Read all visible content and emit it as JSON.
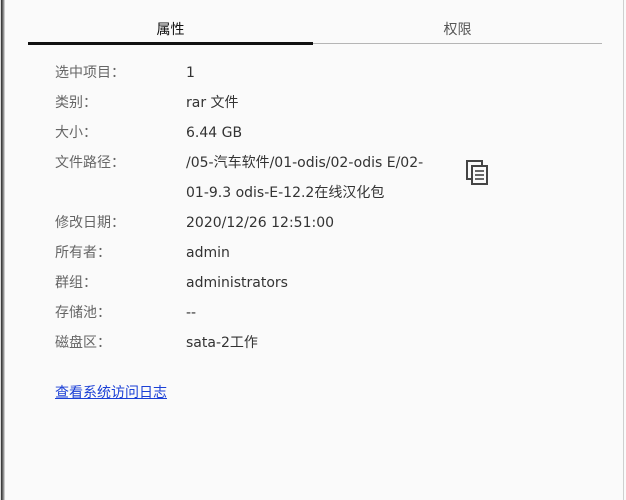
{
  "tabs": [
    {
      "label": "属性",
      "active": true
    },
    {
      "label": "权限",
      "active": false
    }
  ],
  "properties": [
    {
      "label": "选中项目：",
      "value": "1"
    },
    {
      "label": "类别：",
      "value": "rar 文件"
    },
    {
      "label": "大小：",
      "value": "6.44 GB"
    },
    {
      "label": "文件路径：",
      "value": "/05-汽车软件/01-odis/02-odis E/02-01-9.3 odis-E-12.2在线汉化包"
    },
    {
      "label": "修改日期：",
      "value": "2020/12/26 12:51:00"
    },
    {
      "label": "所有者：",
      "value": "admin"
    },
    {
      "label": "群组：",
      "value": "administrators"
    },
    {
      "label": "存储池：",
      "value": "--"
    },
    {
      "label": "磁盘区：",
      "value": "sata-2工作"
    }
  ],
  "copy_icon": "copy-icon",
  "links": {
    "system_log": "查看系统访问日志"
  },
  "colors": {
    "background": "#fafafa",
    "active_tab_underline": "#111111",
    "link": "#1a3fd6",
    "label_text": "#666666",
    "value_text": "#333333"
  }
}
